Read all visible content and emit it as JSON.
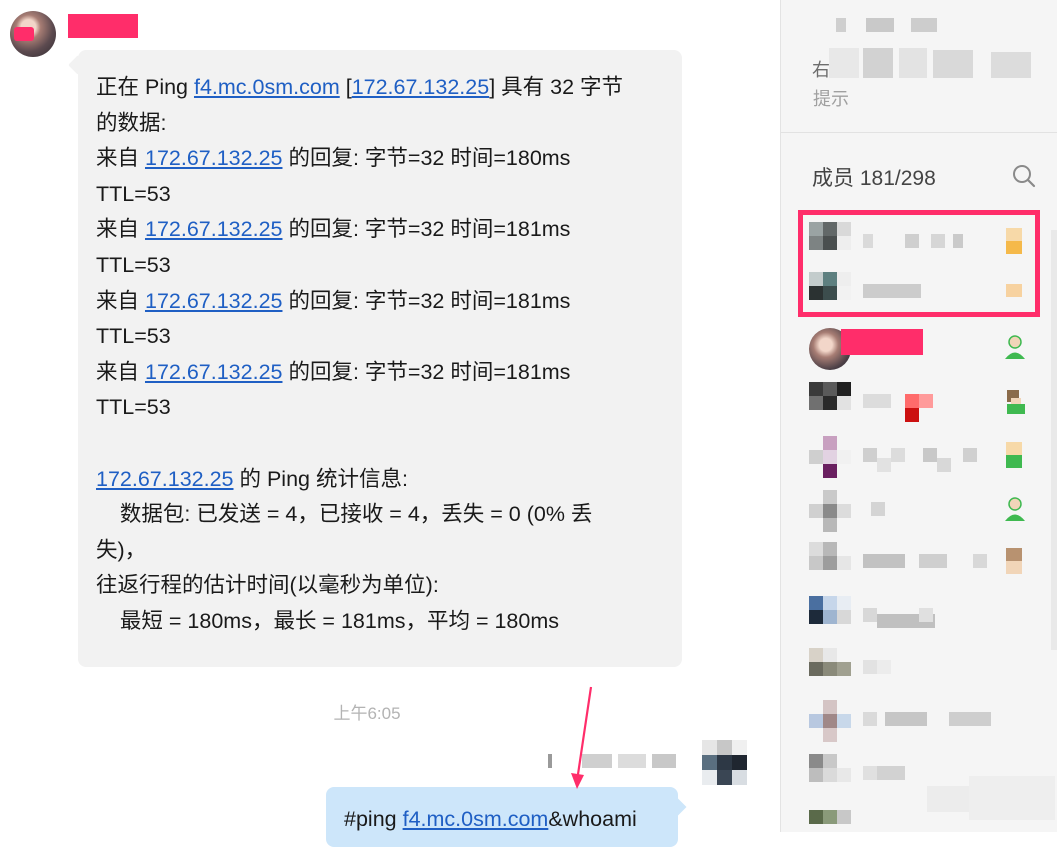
{
  "incoming_message": {
    "lines": [
      {
        "parts": [
          {
            "t": "正在 Ping "
          },
          {
            "t": "f4.mc.0sm.com",
            "link": true
          },
          {
            "t": " ["
          },
          {
            "t": "172.67.132.25",
            "link": true
          },
          {
            "t": "] 具有 32 字节"
          }
        ]
      },
      {
        "parts": [
          {
            "t": "的数据:"
          }
        ]
      },
      {
        "parts": [
          {
            "t": "来自 "
          },
          {
            "t": "172.67.132.25",
            "link": true
          },
          {
            "t": " 的回复: 字节=32 时间=180ms"
          }
        ]
      },
      {
        "parts": [
          {
            "t": "TTL=53"
          }
        ]
      },
      {
        "parts": [
          {
            "t": "来自 "
          },
          {
            "t": "172.67.132.25",
            "link": true
          },
          {
            "t": " 的回复: 字节=32 时间=181ms"
          }
        ]
      },
      {
        "parts": [
          {
            "t": "TTL=53"
          }
        ]
      },
      {
        "parts": [
          {
            "t": "来自 "
          },
          {
            "t": "172.67.132.25",
            "link": true
          },
          {
            "t": " 的回复: 字节=32 时间=181ms"
          }
        ]
      },
      {
        "parts": [
          {
            "t": "TTL=53"
          }
        ]
      },
      {
        "parts": [
          {
            "t": "来自 "
          },
          {
            "t": "172.67.132.25",
            "link": true
          },
          {
            "t": " 的回复: 字节=32 时间=181ms"
          }
        ]
      },
      {
        "parts": [
          {
            "t": "TTL=53"
          }
        ]
      },
      {
        "parts": []
      },
      {
        "parts": [
          {
            "t": "172.67.132.25",
            "link": true
          },
          {
            "t": " 的 Ping 统计信息:"
          }
        ]
      },
      {
        "parts": [
          {
            "t": "    数据包: 已发送 = 4，已接收 = 4，丢失 = 0 (0% 丢"
          }
        ]
      },
      {
        "parts": [
          {
            "t": "失)，"
          }
        ]
      },
      {
        "parts": [
          {
            "t": "往返行程的估计时间(以毫秒为单位):"
          }
        ]
      },
      {
        "parts": [
          {
            "t": "    最短 = 180ms，最长 = 181ms，平均 = 180ms"
          }
        ]
      }
    ]
  },
  "timestamp": "上午6:05",
  "outgoing_message": {
    "parts": [
      {
        "t": "#ping "
      },
      {
        "t": "f4.mc.0sm.com",
        "link": true
      },
      {
        "t": "&whoami"
      }
    ]
  },
  "panel": {
    "notice_char": "右",
    "notice_hint": "提示",
    "members_label": "成员 181/298"
  },
  "colors": {
    "redaction": "#ff2d6a",
    "link": "#1f5fc4",
    "incoming_bubble": "#f2f2f2",
    "outgoing_bubble": "#cde6fa",
    "panel_bg": "#f5f5f5",
    "role_badge": "#f5b94a",
    "member_icon": "#3fb950"
  },
  "icons": {
    "search": "search-icon",
    "member": "person-icon",
    "annotation": "arrow-annotation"
  }
}
